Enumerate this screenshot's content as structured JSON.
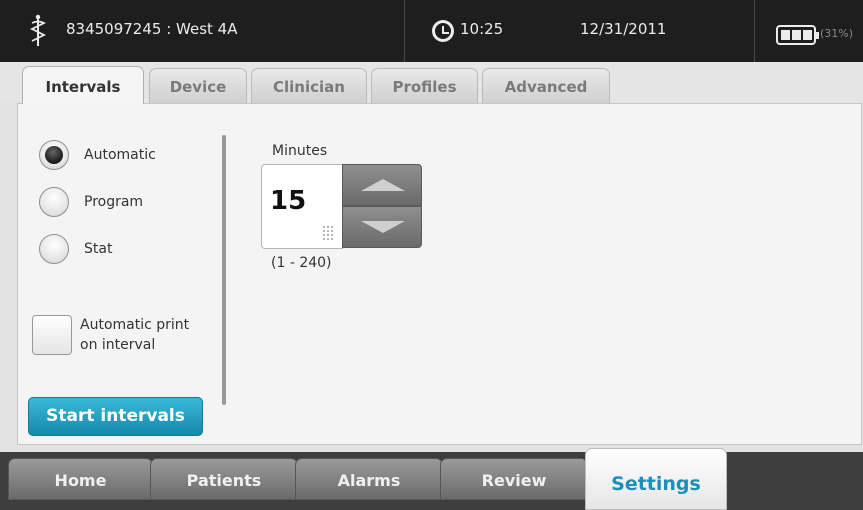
{
  "status_bar": {
    "patient_id": "8345097245",
    "location": "West 4A",
    "patient_location_text": "8345097245 : West 4A",
    "time": "10:25",
    "date": "12/31/2011",
    "battery_percent_text": "(31%)",
    "battery_level": 0.31,
    "icons": [
      "caduceus-icon",
      "clock-icon",
      "battery-icon"
    ]
  },
  "tabs": [
    {
      "label": "Intervals",
      "active": true
    },
    {
      "label": "Device",
      "active": false
    },
    {
      "label": "Clinician",
      "active": false
    },
    {
      "label": "Profiles",
      "active": false
    },
    {
      "label": "Advanced",
      "active": false
    }
  ],
  "intervals": {
    "modes": [
      {
        "label": "Automatic",
        "selected": true
      },
      {
        "label": "Program",
        "selected": false
      },
      {
        "label": "Stat",
        "selected": false
      }
    ],
    "auto_print": {
      "label_line1": "Automatic print",
      "label_line2": "on interval",
      "checked": false
    },
    "minutes": {
      "label": "Minutes",
      "value": "15",
      "range": "(1 - 240)"
    },
    "start_button": "Start intervals"
  },
  "bottom_nav": [
    {
      "label": "Home",
      "active": false
    },
    {
      "label": "Patients",
      "active": false
    },
    {
      "label": "Alarms",
      "active": false
    },
    {
      "label": "Review",
      "active": false
    },
    {
      "label": "Settings",
      "active": true
    }
  ],
  "colors": {
    "status_bar_bg": "#1e1e1e",
    "accent_blue": "#1a8fb9",
    "start_button": "#2aa3c8",
    "panel_bg": "#f4f4f4"
  }
}
